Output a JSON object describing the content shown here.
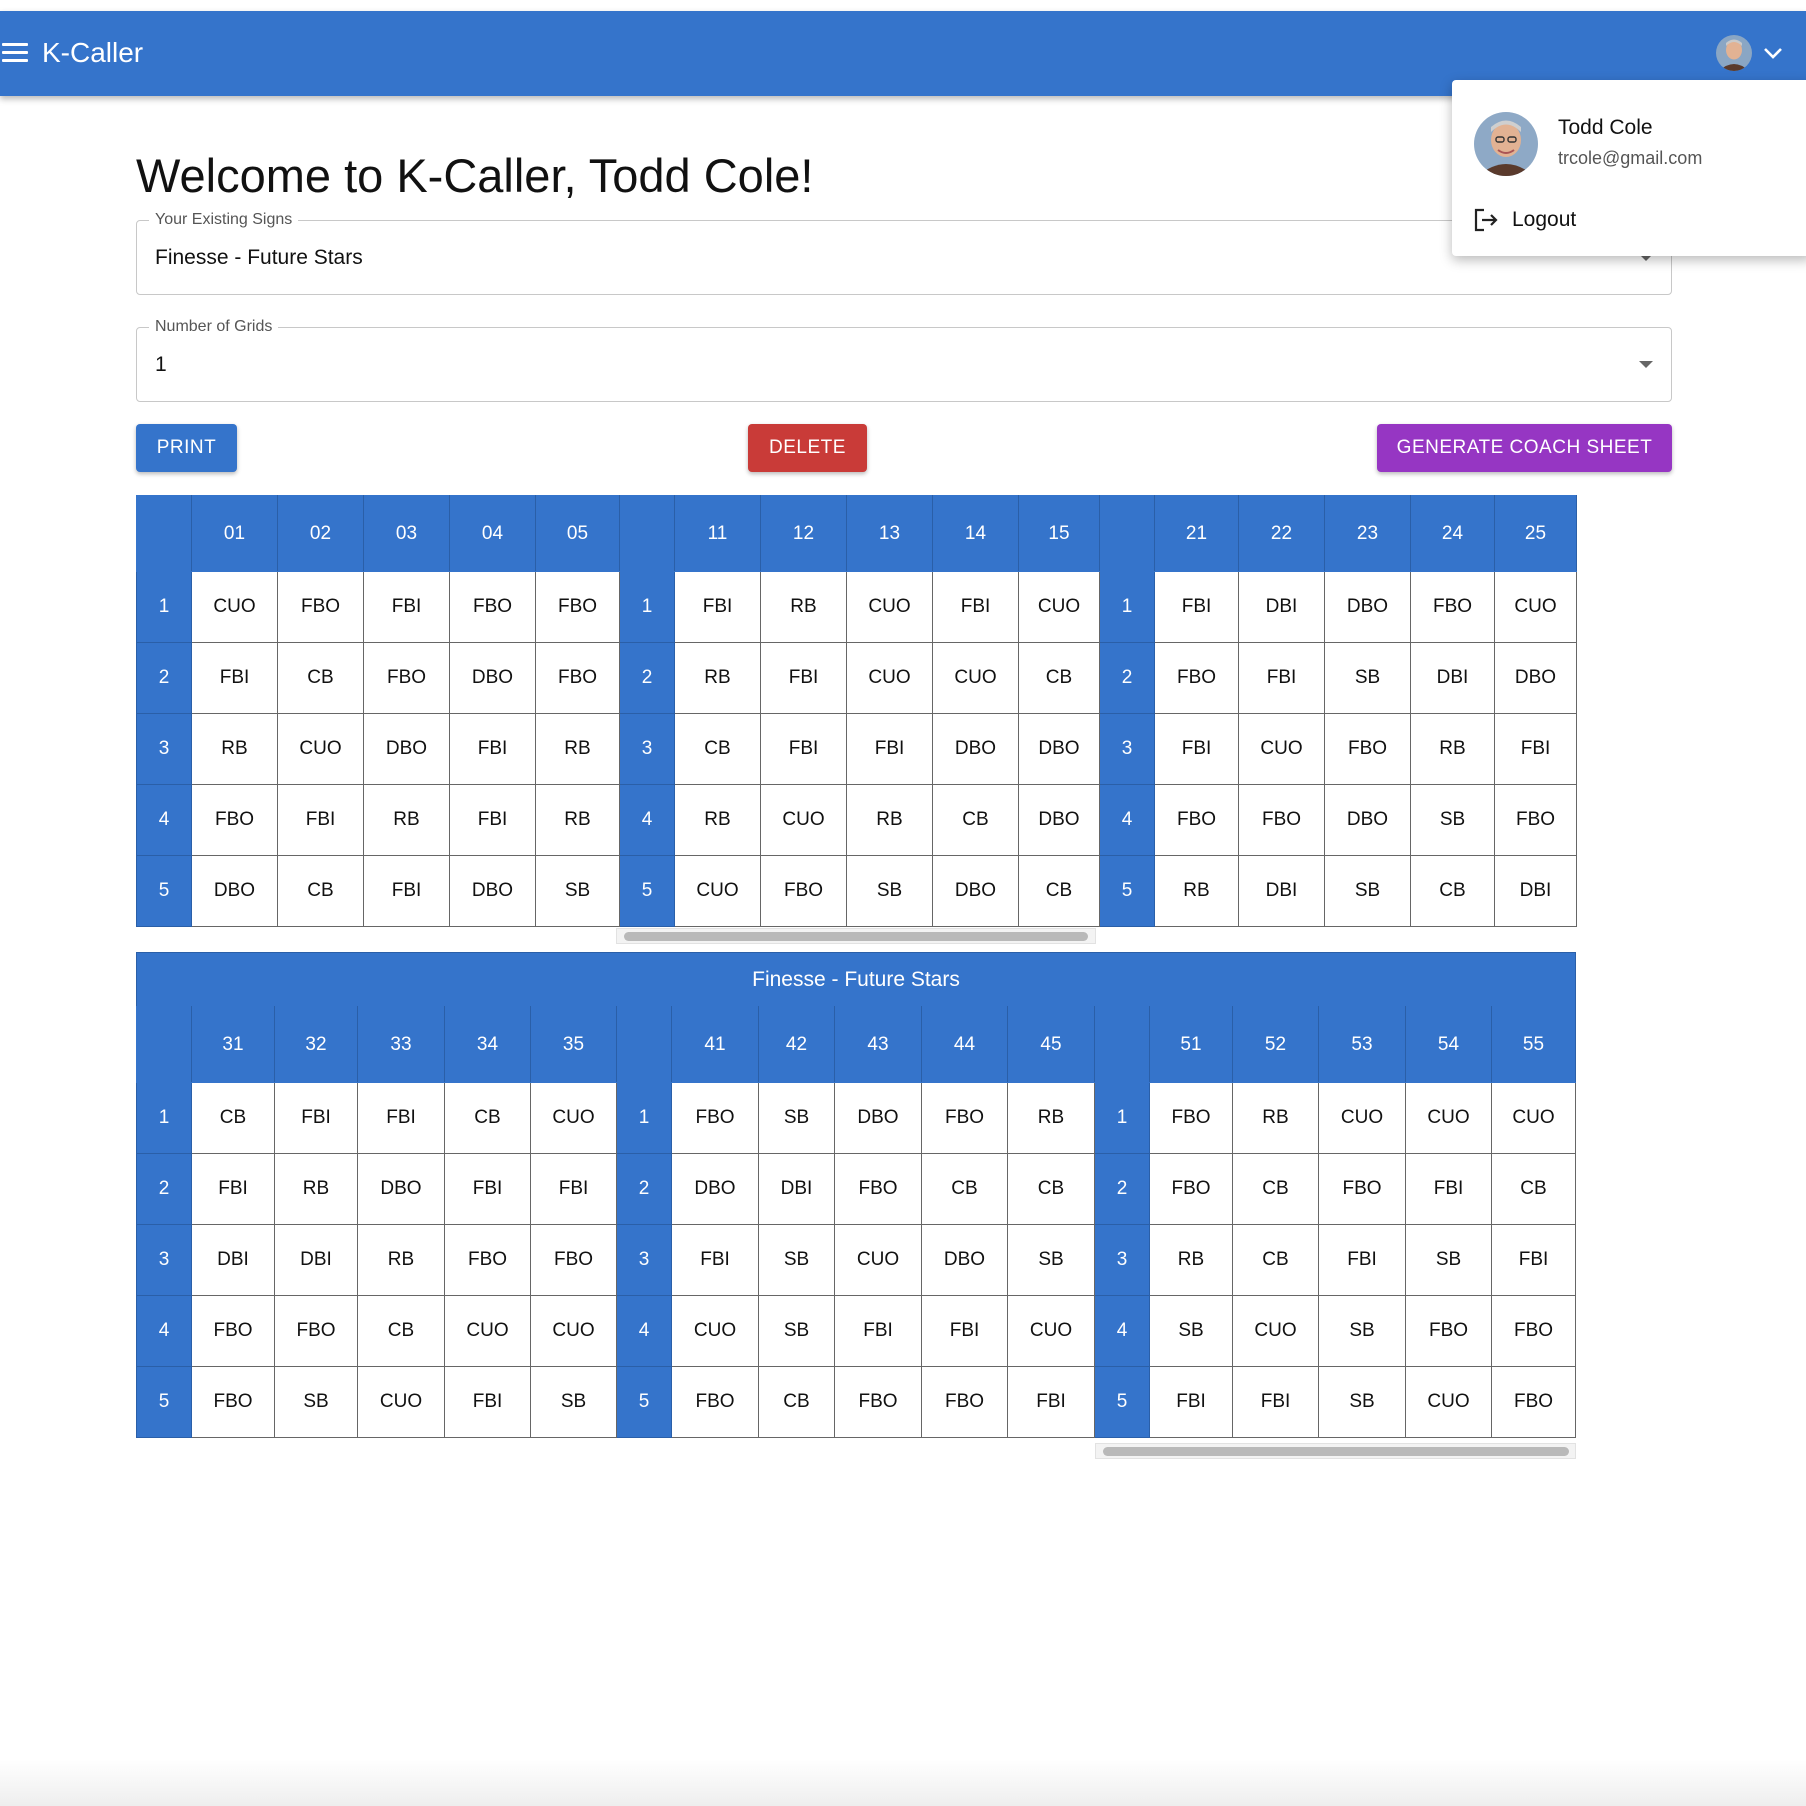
{
  "appbar": {
    "title": "K-Caller"
  },
  "welcome": "Welcome to K-Caller, Todd Cole!",
  "fields": {
    "existing_signs": {
      "label": "Your Existing Signs",
      "value": "Finesse - Future Stars"
    },
    "num_grids": {
      "label": "Number of Grids",
      "value": "1"
    }
  },
  "buttons": {
    "print": "PRINT",
    "delete": "DELETE",
    "coach_sheet": "GENERATE COACH SHEET"
  },
  "colors": {
    "primary": "#3574cb",
    "delete": "#c93b38",
    "coach": "#9636c3"
  },
  "user": {
    "name": "Todd Cole",
    "email": "trcole@gmail.com",
    "logout": "Logout"
  },
  "grid_title": "Finesse - Future Stars",
  "top_grids": [
    {
      "cols": [
        "01",
        "02",
        "03",
        "04",
        "05"
      ],
      "rows": [
        {
          "label": "1",
          "cells": [
            "CUO",
            "FBO",
            "FBI",
            "FBO",
            "FBO"
          ]
        },
        {
          "label": "2",
          "cells": [
            "FBI",
            "CB",
            "FBO",
            "DBO",
            "FBO"
          ]
        },
        {
          "label": "3",
          "cells": [
            "RB",
            "CUO",
            "DBO",
            "FBI",
            "RB"
          ]
        },
        {
          "label": "4",
          "cells": [
            "FBO",
            "FBI",
            "RB",
            "FBI",
            "RB"
          ]
        },
        {
          "label": "5",
          "cells": [
            "DBO",
            "CB",
            "FBI",
            "DBO",
            "SB"
          ]
        }
      ]
    },
    {
      "cols": [
        "11",
        "12",
        "13",
        "14",
        "15"
      ],
      "rows": [
        {
          "label": "1",
          "cells": [
            "FBI",
            "RB",
            "CUO",
            "FBI",
            "CUO"
          ]
        },
        {
          "label": "2",
          "cells": [
            "RB",
            "FBI",
            "CUO",
            "CUO",
            "CB"
          ]
        },
        {
          "label": "3",
          "cells": [
            "CB",
            "FBI",
            "FBI",
            "DBO",
            "DBO"
          ]
        },
        {
          "label": "4",
          "cells": [
            "RB",
            "CUO",
            "RB",
            "CB",
            "DBO"
          ]
        },
        {
          "label": "5",
          "cells": [
            "CUO",
            "FBO",
            "SB",
            "DBO",
            "CB"
          ]
        }
      ]
    },
    {
      "cols": [
        "21",
        "22",
        "23",
        "24",
        "25"
      ],
      "rows": [
        {
          "label": "1",
          "cells": [
            "FBI",
            "DBI",
            "DBO",
            "FBO",
            "CUO"
          ]
        },
        {
          "label": "2",
          "cells": [
            "FBO",
            "FBI",
            "SB",
            "DBI",
            "DBO"
          ]
        },
        {
          "label": "3",
          "cells": [
            "FBI",
            "CUO",
            "FBO",
            "RB",
            "FBI"
          ]
        },
        {
          "label": "4",
          "cells": [
            "FBO",
            "FBO",
            "DBO",
            "SB",
            "FBO"
          ]
        },
        {
          "label": "5",
          "cells": [
            "RB",
            "DBI",
            "SB",
            "CB",
            "DBI"
          ]
        }
      ]
    }
  ],
  "bottom_grids": [
    {
      "cols": [
        "31",
        "32",
        "33",
        "34",
        "35"
      ],
      "rows": [
        {
          "label": "1",
          "cells": [
            "CB",
            "FBI",
            "FBI",
            "CB",
            "CUO"
          ]
        },
        {
          "label": "2",
          "cells": [
            "FBI",
            "RB",
            "DBO",
            "FBI",
            "FBI"
          ]
        },
        {
          "label": "3",
          "cells": [
            "DBI",
            "DBI",
            "RB",
            "FBO",
            "FBO"
          ]
        },
        {
          "label": "4",
          "cells": [
            "FBO",
            "FBO",
            "CB",
            "CUO",
            "CUO"
          ]
        },
        {
          "label": "5",
          "cells": [
            "FBO",
            "SB",
            "CUO",
            "FBI",
            "SB"
          ]
        }
      ]
    },
    {
      "cols": [
        "41",
        "42",
        "43",
        "44",
        "45"
      ],
      "rows": [
        {
          "label": "1",
          "cells": [
            "FBO",
            "SB",
            "DBO",
            "FBO",
            "RB"
          ]
        },
        {
          "label": "2",
          "cells": [
            "DBO",
            "DBI",
            "FBO",
            "CB",
            "CB"
          ]
        },
        {
          "label": "3",
          "cells": [
            "FBI",
            "SB",
            "CUO",
            "DBO",
            "SB"
          ]
        },
        {
          "label": "4",
          "cells": [
            "CUO",
            "SB",
            "FBI",
            "FBI",
            "CUO"
          ]
        },
        {
          "label": "5",
          "cells": [
            "FBO",
            "CB",
            "FBO",
            "FBO",
            "FBI"
          ]
        }
      ]
    },
    {
      "cols": [
        "51",
        "52",
        "53",
        "54",
        "55"
      ],
      "rows": [
        {
          "label": "1",
          "cells": [
            "FBO",
            "RB",
            "CUO",
            "CUO",
            "CUO"
          ]
        },
        {
          "label": "2",
          "cells": [
            "FBO",
            "CB",
            "FBO",
            "FBI",
            "CB"
          ]
        },
        {
          "label": "3",
          "cells": [
            "RB",
            "CB",
            "FBI",
            "SB",
            "FBI"
          ]
        },
        {
          "label": "4",
          "cells": [
            "SB",
            "CUO",
            "SB",
            "FBO",
            "FBO"
          ]
        },
        {
          "label": "5",
          "cells": [
            "FBI",
            "FBI",
            "SB",
            "CUO",
            "FBO"
          ]
        }
      ]
    }
  ]
}
